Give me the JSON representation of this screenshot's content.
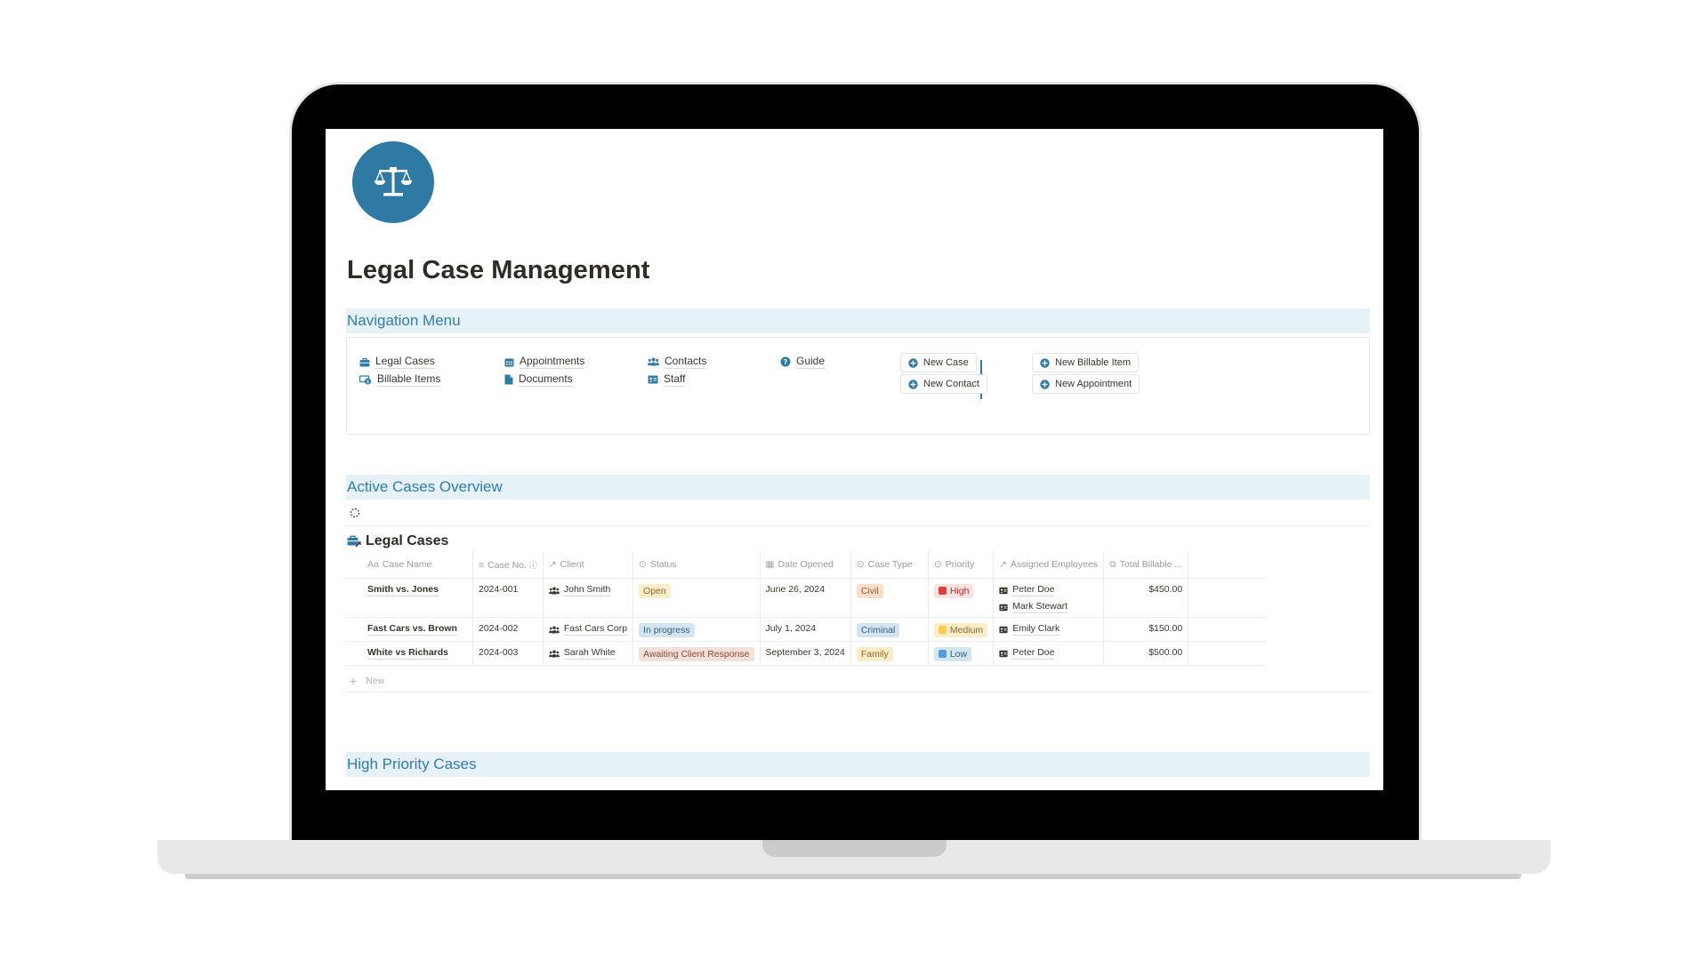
{
  "page": {
    "title": "Legal Case Management",
    "icon": "balance-scale-icon"
  },
  "navigation": {
    "heading": "Navigation Menu",
    "links": [
      {
        "label": "Legal Cases",
        "icon": "briefcase-icon"
      },
      {
        "label": "Billable Items",
        "icon": "money-bill-icon"
      },
      {
        "label": "Appointments",
        "icon": "calendar-icon"
      },
      {
        "label": "Documents",
        "icon": "document-icon"
      },
      {
        "label": "Contacts",
        "icon": "users-icon"
      },
      {
        "label": "Staff",
        "icon": "id-card-icon"
      },
      {
        "label": "Guide",
        "icon": "question-circle-icon"
      }
    ],
    "quick_actions": [
      {
        "label": "New Case",
        "icon": "plus-circle-icon"
      },
      {
        "label": "New Contact",
        "icon": "plus-circle-icon"
      },
      {
        "label": "New Billable Item",
        "icon": "plus-circle-icon"
      },
      {
        "label": "New Appointment",
        "icon": "plus-circle-icon"
      }
    ]
  },
  "active_cases": {
    "heading": "Active Cases Overview",
    "database_title": "Legal Cases",
    "columns": [
      {
        "label": "Case Name",
        "icon": "Aa"
      },
      {
        "label": "Case No.",
        "icon": "text-lines-icon"
      },
      {
        "label": "Client",
        "icon": "relation-arrow-icon"
      },
      {
        "label": "Status",
        "icon": "status-icon"
      },
      {
        "label": "Date Opened",
        "icon": "calendar-icon"
      },
      {
        "label": "Case Type",
        "icon": "select-icon"
      },
      {
        "label": "Priority",
        "icon": "select-icon"
      },
      {
        "label": "Assigned Employees",
        "icon": "relation-arrow-icon"
      },
      {
        "label": "Total Billable ...",
        "icon": "money-bill-icon"
      }
    ],
    "rows": [
      {
        "case_name": "Smith vs. Jones",
        "case_no": "2024-001",
        "client": "John Smith",
        "status": "Open",
        "date_opened": "June 26, 2024",
        "case_type": "Civil",
        "priority": "High",
        "employees": [
          "Peter Doe",
          "Mark Stewart"
        ],
        "total_billable": "$450.00"
      },
      {
        "case_name": "Fast Cars vs. Brown",
        "case_no": "2024-002",
        "client": "Fast Cars Corp",
        "status": "In progress",
        "date_opened": "July 1, 2024",
        "case_type": "Criminal",
        "priority": "Medium",
        "employees": [
          "Emily Clark"
        ],
        "total_billable": "$150.00"
      },
      {
        "case_name": "White vs Richards",
        "case_no": "2024-003",
        "client": "Sarah White",
        "status": "Awaiting Client Response",
        "date_opened": "September 3, 2024",
        "case_type": "Family",
        "priority": "Low",
        "employees": [
          "Peter Doe"
        ],
        "total_billable": "$500.00"
      }
    ],
    "new_row_label": "New"
  },
  "high_priority": {
    "heading": "High Priority Cases"
  },
  "colors": {
    "accent": "#2e7aa5",
    "section_bg": "#e7f1f8",
    "section_text": "#2f7cae",
    "status_open_bg": "#fdecc8",
    "status_in_progress_bg": "#d3e5ef",
    "status_awaiting_bg": "#f5e0d9",
    "type_civil_bg": "#fadec9",
    "type_criminal_bg": "#d3e5ef",
    "type_family_bg": "#fdecc8",
    "priority_high": "#e03e3e",
    "priority_medium": "#ffc94a",
    "priority_low": "#529cdb"
  }
}
